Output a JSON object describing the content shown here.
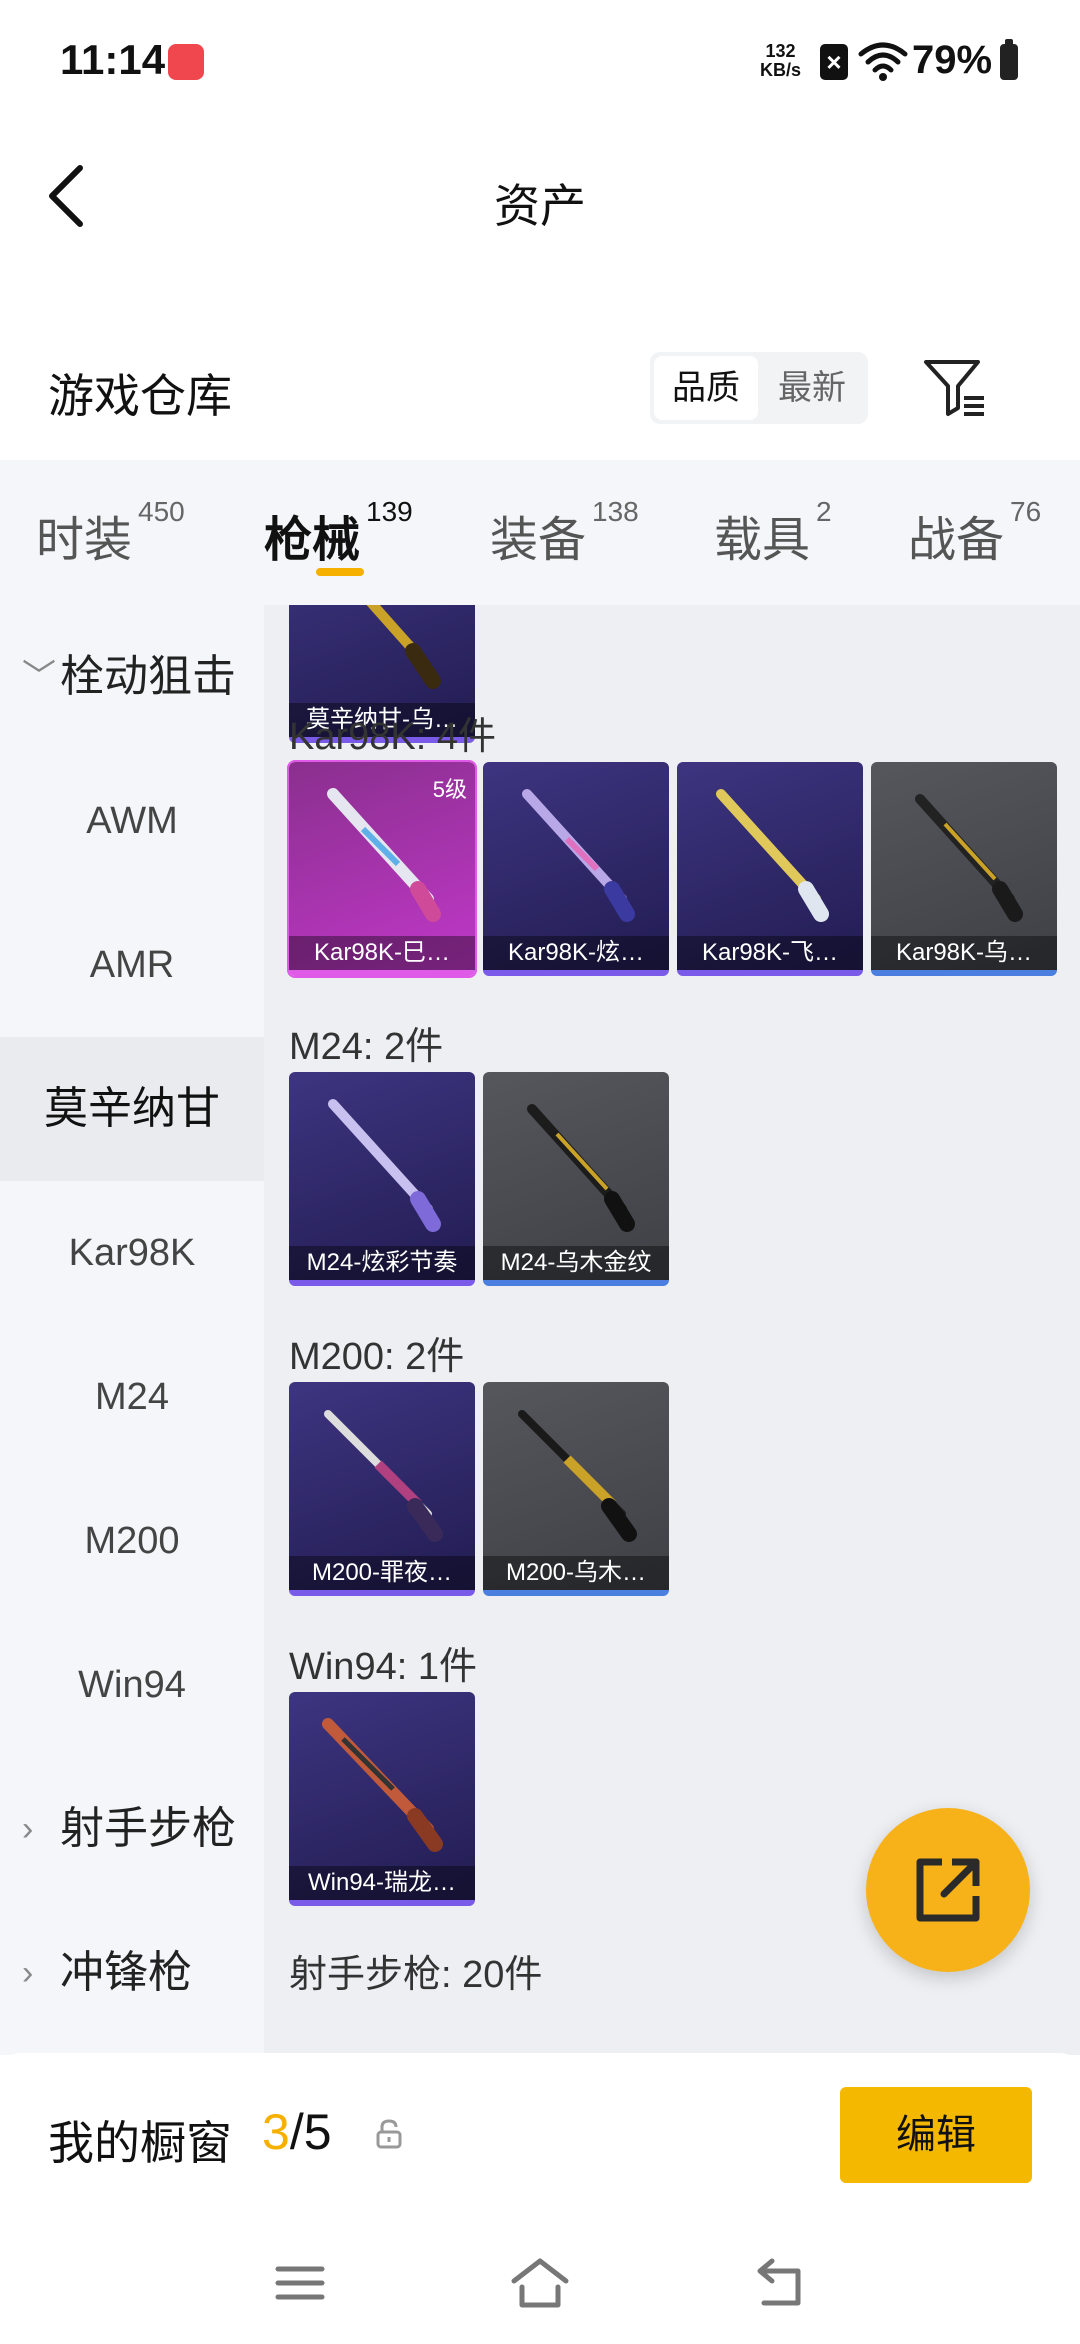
{
  "status_bar": {
    "time": "11:14",
    "net_speed_value": "132",
    "net_speed_unit": "KB/s",
    "battery": "79%"
  },
  "header": {
    "title": "资产"
  },
  "warehouse": {
    "title": "游戏仓库",
    "sort_quality": "品质",
    "sort_newest": "最新"
  },
  "tabs": [
    {
      "label": "时装",
      "count": "450"
    },
    {
      "label": "枪械",
      "count": "139",
      "active": true
    },
    {
      "label": "装备",
      "count": "138"
    },
    {
      "label": "载具",
      "count": "2"
    },
    {
      "label": "战备",
      "count": "76"
    }
  ],
  "sidebar": {
    "items": [
      {
        "label": "栓动狙击",
        "type": "group",
        "expanded": true
      },
      {
        "label": "AWM"
      },
      {
        "label": "AMR"
      },
      {
        "label": "莫辛纳甘",
        "selected": true
      },
      {
        "label": "Kar98K"
      },
      {
        "label": "M24"
      },
      {
        "label": "M200"
      },
      {
        "label": "Win94"
      },
      {
        "label": "射手步枪",
        "type": "group"
      },
      {
        "label": "冲锋枪",
        "type": "group"
      }
    ]
  },
  "content": {
    "top_card": {
      "name": "莫辛纳甘-乌…"
    },
    "sections": [
      {
        "label": "Kar98K: 4件",
        "items": [
          {
            "name": "Kar98K-巳…",
            "level": "5级",
            "rarity": "pink"
          },
          {
            "name": "Kar98K-炫…",
            "rarity": "purple"
          },
          {
            "name": "Kar98K-飞…",
            "rarity": "purple"
          },
          {
            "name": "Kar98K-乌…",
            "rarity": "gray"
          }
        ]
      },
      {
        "label": "M24: 2件",
        "items": [
          {
            "name": "M24-炫彩节奏",
            "rarity": "purple"
          },
          {
            "name": "M24-乌木金纹",
            "rarity": "gray"
          }
        ]
      },
      {
        "label": "M200: 2件",
        "items": [
          {
            "name": "M200-罪夜…",
            "rarity": "purple"
          },
          {
            "name": "M200-乌木…",
            "rarity": "gray"
          }
        ]
      },
      {
        "label": "Win94: 1件",
        "items": [
          {
            "name": "Win94-瑞龙…",
            "rarity": "purple"
          }
        ]
      },
      {
        "label": "射手步枪: 20件",
        "items": []
      }
    ]
  },
  "showcase": {
    "label": "我的橱窗",
    "current": "3",
    "total": "/5",
    "edit_label": "编辑"
  },
  "colors": {
    "accent": "#f5b000",
    "fab": "#f7b21a"
  }
}
